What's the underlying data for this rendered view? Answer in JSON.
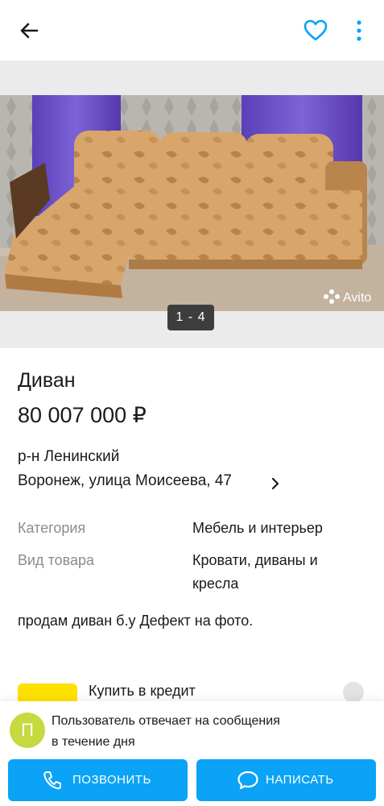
{
  "header": {
    "back_icon": "arrow-left-icon",
    "favorite_icon": "heart-outline-icon",
    "more_icon": "more-vertical-icon",
    "accent": "#0aa3f6"
  },
  "gallery": {
    "counter": "1 - 4",
    "watermark": "Avito"
  },
  "listing": {
    "title": "Диван",
    "price": "80 007 000 ₽",
    "district": "р-н Ленинский",
    "address": "Воронеж, улица Моисеева, 47"
  },
  "params": [
    {
      "key": "Категория",
      "value": "Мебель и интерьер"
    },
    {
      "key": "Вид товара",
      "value_line1": "Кровати, диваны и",
      "value_line2": "кресла"
    }
  ],
  "description": "продам диван б.у  Дефект на фото.",
  "credit": {
    "label": "Купить в кредит",
    "badge_color": "#ffe100"
  },
  "seller": {
    "avatar_letter": "П",
    "avatar_color": "#c6d93e",
    "notice_line1": "Пользователь отвечает на сообщения",
    "notice_line2": "в течение дня"
  },
  "actions": {
    "call_label": "ПОЗВОНИТЬ",
    "write_label": "НАПИСАТЬ"
  }
}
